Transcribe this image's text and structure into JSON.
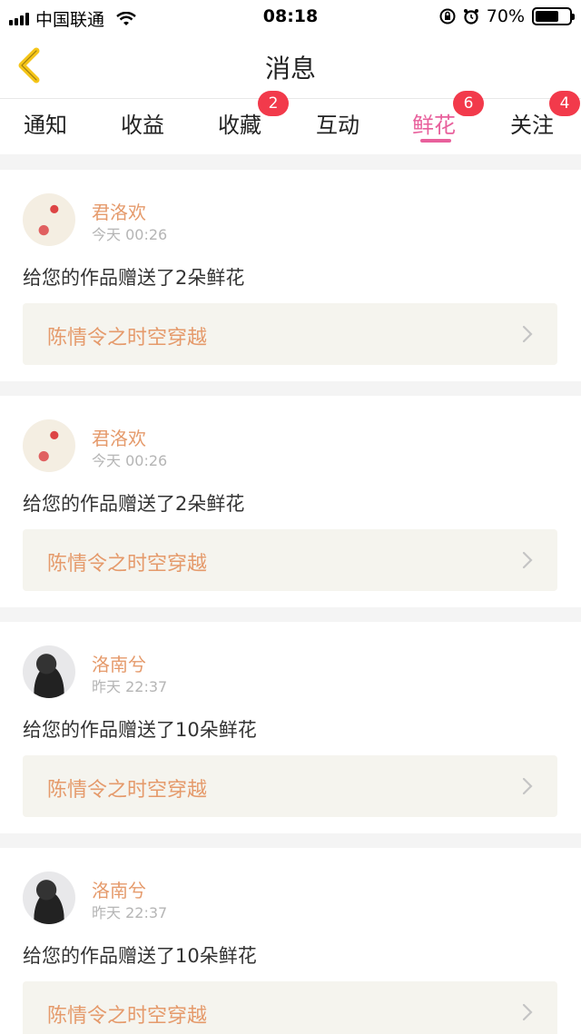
{
  "status_bar": {
    "carrier": "中国联通",
    "time": "08:18",
    "battery": "70%",
    "battery_level": 0.7,
    "icons": [
      "signal-icon",
      "wifi-icon",
      "rotation-lock-icon",
      "alarm-icon",
      "battery-icon"
    ]
  },
  "nav": {
    "title": "消息",
    "back_icon": "back-chevron-icon"
  },
  "tabs": [
    {
      "label": "通知",
      "badge": ""
    },
    {
      "label": "收益",
      "badge": ""
    },
    {
      "label": "收藏",
      "badge": "2"
    },
    {
      "label": "互动",
      "badge": ""
    },
    {
      "label": "鲜花",
      "badge": "6",
      "active": true
    },
    {
      "label": "关注",
      "badge": "4"
    }
  ],
  "messages": [
    {
      "user": "君洛欢",
      "time": "今天 00:26",
      "text": "给您的作品赠送了2朵鲜花",
      "work": "陈情令之时空穿越",
      "avatar": "flower-avatar"
    },
    {
      "user": "君洛欢",
      "time": "今天 00:26",
      "text": "给您的作品赠送了2朵鲜花",
      "work": "陈情令之时空穿越",
      "avatar": "flower-avatar"
    },
    {
      "user": "洛南兮",
      "time": "昨天 22:37",
      "text": "给您的作品赠送了10朵鲜花",
      "work": "陈情令之时空穿越",
      "avatar": "person-avatar"
    },
    {
      "user": "洛南兮",
      "time": "昨天 22:37",
      "text": "给您的作品赠送了10朵鲜花",
      "work": "陈情令之时空穿越",
      "avatar": "person-avatar"
    }
  ],
  "colors": {
    "accent": "#e8609c",
    "badge": "#f23a4b",
    "username": "#e59a6b",
    "back_icon": "#f5c518",
    "link_bg": "#f5f4ee"
  }
}
